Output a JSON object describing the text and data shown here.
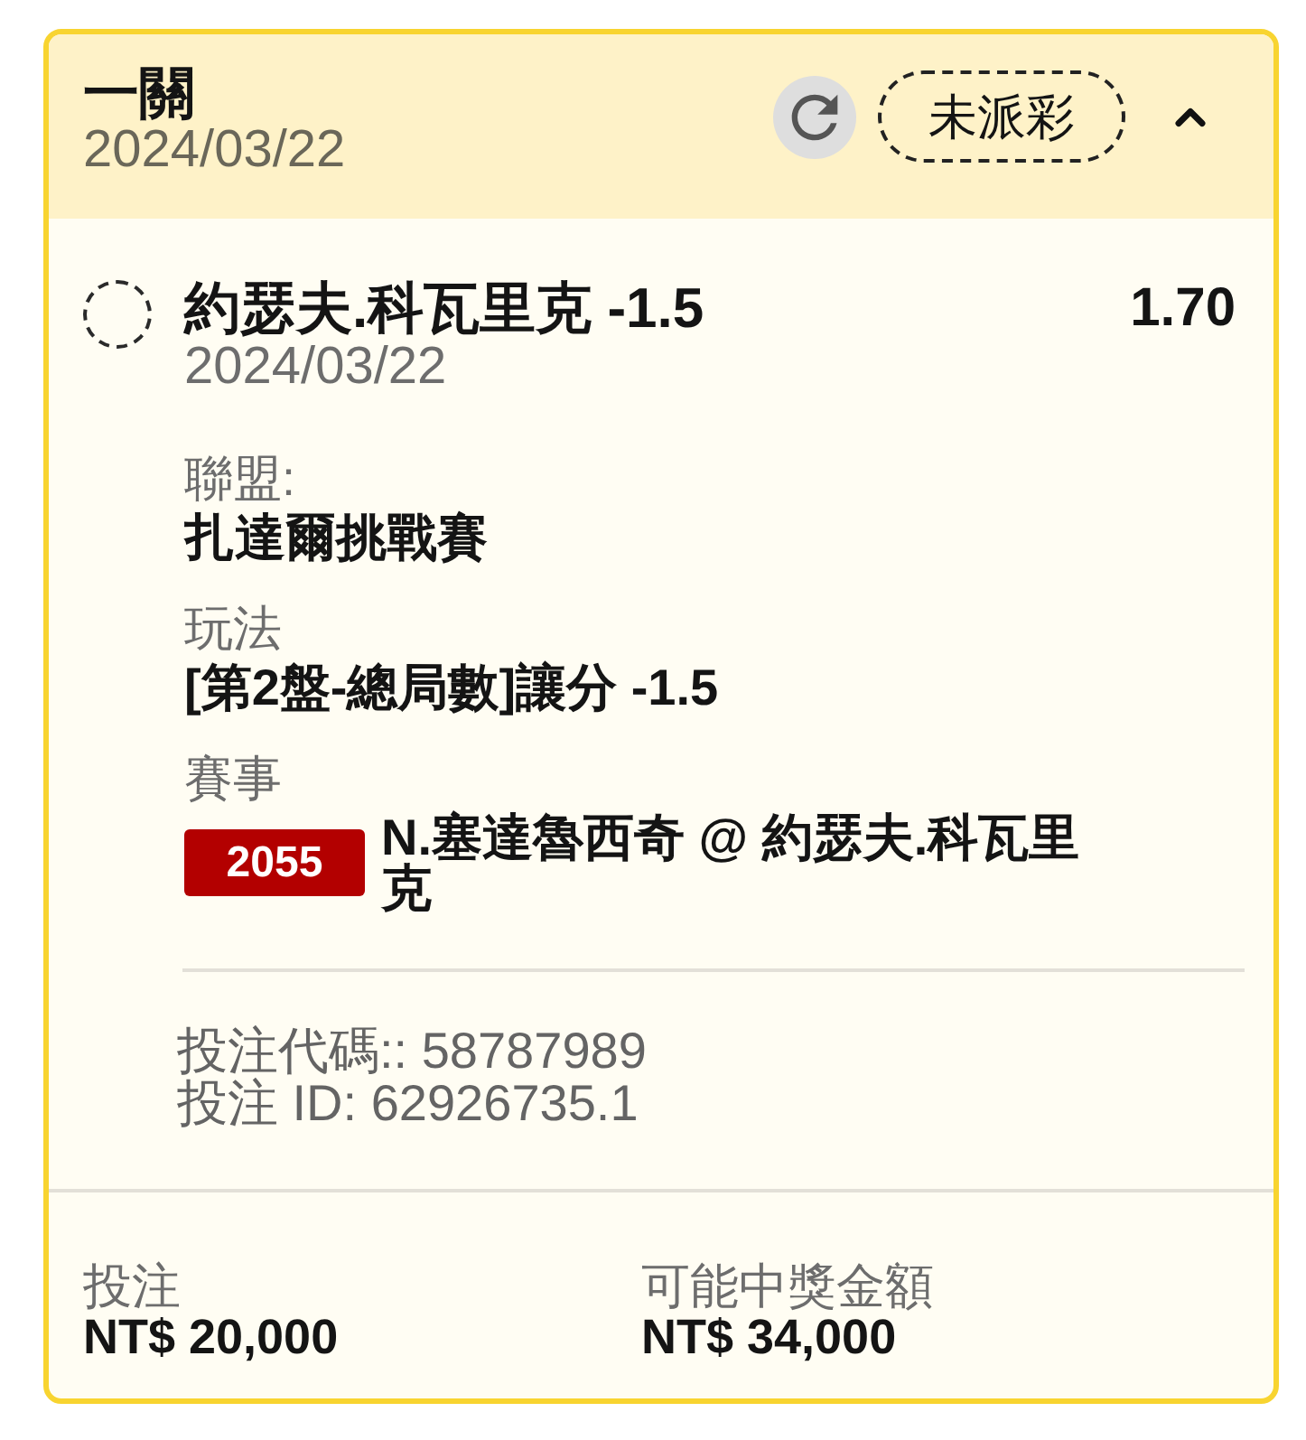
{
  "header": {
    "title": "一關",
    "date": "2024/03/22",
    "status": "未派彩",
    "expanded": true
  },
  "selection": {
    "name": "約瑟夫.科瓦里克 -1.5",
    "date": "2024/03/22",
    "odds": "1.70"
  },
  "details": [
    {
      "kind": "text",
      "label": "聯盟:",
      "value": "扎達爾挑戰賽"
    },
    {
      "kind": "text",
      "label": "玩法",
      "value": "[第2盤-總局數]讓分 -1.5"
    },
    {
      "kind": "event",
      "label": "賽事",
      "code": "2055",
      "value": "N.塞達魯西奇 @ 約瑟夫.科瓦里克"
    }
  ],
  "references": [
    "投注代碼:: 58787989",
    "投注 ID: 62926735.1"
  ],
  "footer": [
    {
      "label": "投注",
      "value": "NT$ 20,000"
    },
    {
      "label": "可能中獎金額",
      "value": "NT$ 34,000"
    }
  ]
}
